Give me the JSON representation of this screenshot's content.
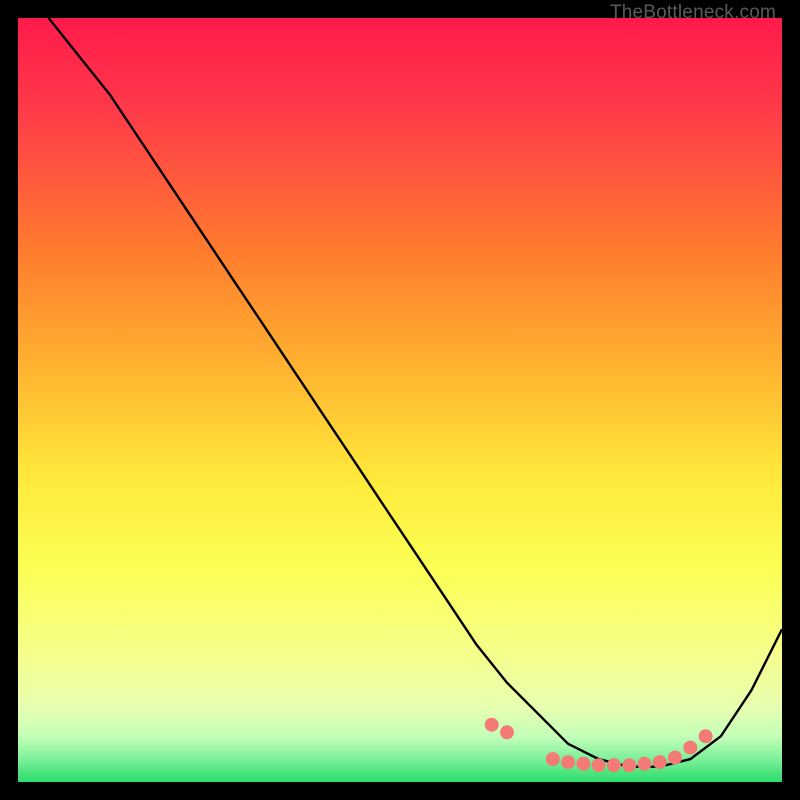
{
  "watermark": "TheBottleneck.com",
  "colors": {
    "bg": "#000000",
    "curve": "#000000",
    "dots": "#f47a76",
    "gradient_top": "#ff1a4b",
    "gradient_mid1": "#ff7a2e",
    "gradient_mid2": "#ffe93a",
    "gradient_mid3": "#f6ff6a",
    "gradient_bottom": "#2bdc6e"
  },
  "chart_data": {
    "type": "line",
    "title": "",
    "xlabel": "",
    "ylabel": "",
    "xlim": [
      0,
      100
    ],
    "ylim": [
      0,
      100
    ],
    "curve": {
      "x": [
        4,
        8,
        12,
        16,
        20,
        24,
        28,
        32,
        36,
        40,
        44,
        48,
        52,
        56,
        60,
        64,
        68,
        72,
        76,
        80,
        84,
        88,
        92,
        96,
        100
      ],
      "y": [
        100,
        95,
        90,
        84,
        78,
        72,
        66,
        60,
        54,
        48,
        42,
        36,
        30,
        24,
        18,
        13,
        9,
        5,
        3,
        2,
        2,
        3,
        6,
        12,
        20
      ]
    },
    "dots": {
      "x": [
        62,
        64,
        70,
        72,
        74,
        76,
        78,
        80,
        82,
        84,
        86,
        88,
        90
      ],
      "y": [
        7.5,
        6.5,
        3.0,
        2.6,
        2.4,
        2.2,
        2.2,
        2.2,
        2.4,
        2.6,
        3.2,
        4.5,
        6.0
      ]
    }
  }
}
